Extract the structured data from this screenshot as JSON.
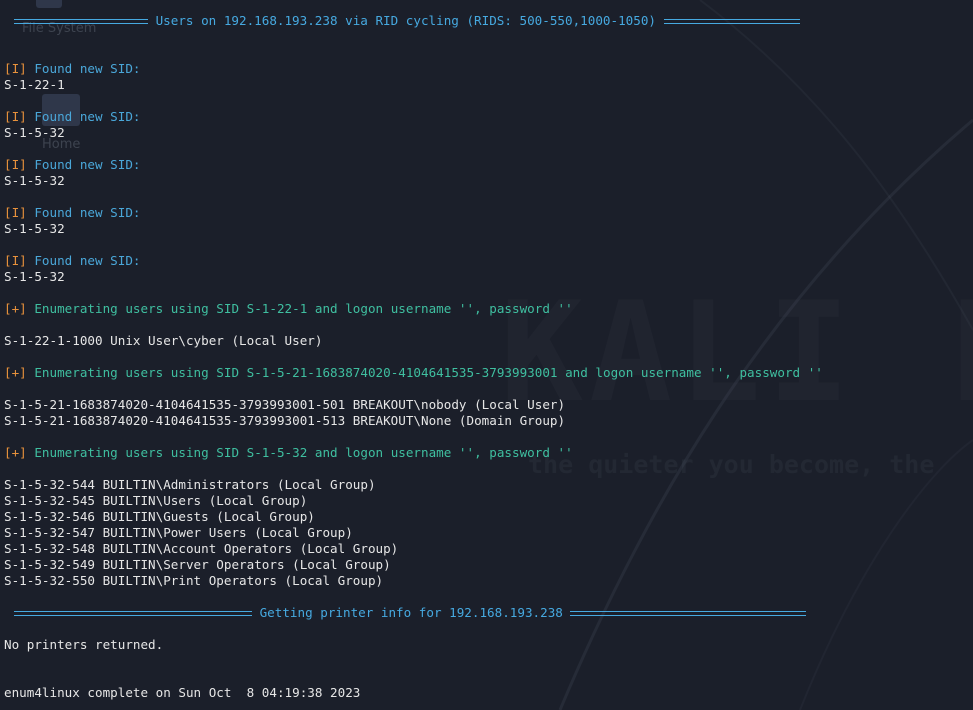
{
  "window": {
    "background": "#1b1f2a",
    "accent_blue": "#46a9e0",
    "accent_orange": "#e8923c",
    "accent_green": "#3fbfa0"
  },
  "desktop": {
    "filesystem_label": "File System",
    "home_label": "Home",
    "watermark_logo": "KALI L",
    "watermark_tagline": "the quieter you become, the"
  },
  "terminal": {
    "banner_rid": " Users on 192.168.193.238 via RID cycling (RIDS: 500-550,1000-1050) ",
    "sid_found": [
      {
        "tag": "[I]",
        "message": " Found new SID:",
        "sid": "S-1-22-1"
      },
      {
        "tag": "[I]",
        "message": " Found new SID:",
        "sid": "S-1-5-32"
      },
      {
        "tag": "[I]",
        "message": " Found new SID:",
        "sid": "S-1-5-32"
      },
      {
        "tag": "[I]",
        "message": " Found new SID:",
        "sid": "S-1-5-32"
      },
      {
        "tag": "[I]",
        "message": " Found new SID:",
        "sid": "S-1-5-32"
      }
    ],
    "enum_blocks": [
      {
        "tag": "[+]",
        "message": " Enumerating users using SID S-1-22-1 and logon username '', password ''",
        "results": [
          "S-1-22-1-1000 Unix User\\cyber (Local User)"
        ]
      },
      {
        "tag": "[+]",
        "message": " Enumerating users using SID S-1-5-21-1683874020-4104641535-3793993001 and logon username '', password ''",
        "results": [
          "S-1-5-21-1683874020-4104641535-3793993001-501 BREAKOUT\\nobody (Local User)",
          "S-1-5-21-1683874020-4104641535-3793993001-513 BREAKOUT\\None (Domain Group)"
        ]
      },
      {
        "tag": "[+]",
        "message": " Enumerating users using SID S-1-5-32 and logon username '', password ''",
        "results": [
          "S-1-5-32-544 BUILTIN\\Administrators (Local Group)",
          "S-1-5-32-545 BUILTIN\\Users (Local Group)",
          "S-1-5-32-546 BUILTIN\\Guests (Local Group)",
          "S-1-5-32-547 BUILTIN\\Power Users (Local Group)",
          "S-1-5-32-548 BUILTIN\\Account Operators (Local Group)",
          "S-1-5-32-549 BUILTIN\\Server Operators (Local Group)",
          "S-1-5-32-550 BUILTIN\\Print Operators (Local Group)"
        ]
      }
    ],
    "banner_printer": " Getting printer info for 192.168.193.238 ",
    "printer_result": "No printers returned.",
    "completion": "enum4linux complete on Sun Oct  8 04:19:38 2023"
  }
}
